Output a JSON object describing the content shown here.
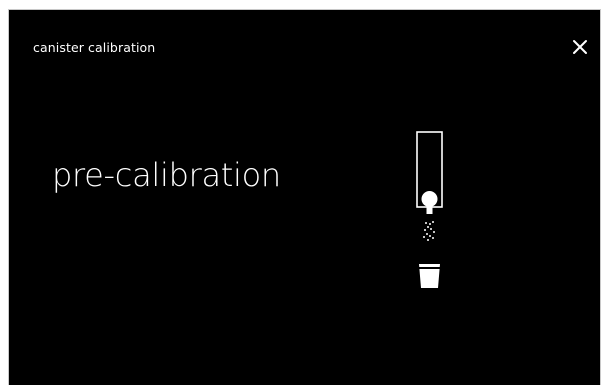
{
  "dialog": {
    "title": "canister calibration",
    "close_icon": "close-icon"
  },
  "main": {
    "heading": "pre-calibration",
    "illustration_icons": [
      "canister-icon",
      "dispensing-spray-icon",
      "cup-icon"
    ]
  },
  "colors": {
    "background": "#000000",
    "foreground": "#ffffff",
    "frame_border": "#c8c8c8"
  }
}
